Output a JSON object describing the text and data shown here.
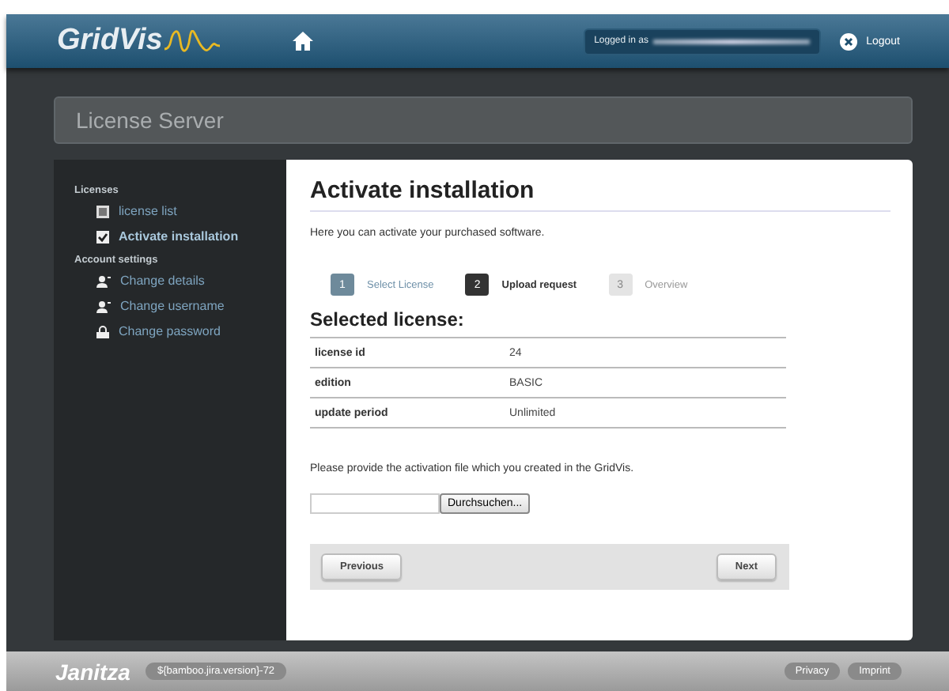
{
  "header": {
    "logo": "GridVis",
    "user_label": "Logged in as",
    "logout": "Logout"
  },
  "page_title": "License Server",
  "sidebar": {
    "sections": [
      {
        "title": "Licenses",
        "items": [
          {
            "label": "license list",
            "kind": "list",
            "selected": false
          },
          {
            "label": "Activate installation",
            "kind": "check",
            "selected": true
          }
        ]
      },
      {
        "title": "Account settings",
        "items": [
          {
            "label": "Change details",
            "kind": "user",
            "selected": false
          },
          {
            "label": "Change username",
            "kind": "user",
            "selected": false
          },
          {
            "label": "Change password",
            "kind": "lock",
            "selected": false
          }
        ]
      }
    ]
  },
  "content": {
    "title": "Activate installation",
    "intro": "Here you can activate your purchased software.",
    "steps": [
      {
        "number": "1",
        "label": "Select License",
        "completed": true,
        "selected": false
      },
      {
        "number": "2",
        "label": "Upload request",
        "completed": false,
        "selected": true
      },
      {
        "number": "3",
        "label": "Overview",
        "completed": false,
        "selected": false
      }
    ],
    "license_heading": "Selected license:",
    "license_rows": [
      {
        "label": "license id",
        "value": "24"
      },
      {
        "label": "edition",
        "value": "BASIC"
      },
      {
        "label": "update period",
        "value": "Unlimited"
      }
    ],
    "file_prompt": "Please provide the activation file which you created in the GridVis.",
    "browse_button": "Durchsuchen...",
    "previous_button": "Previous",
    "next_button": "Next"
  },
  "footer": {
    "logo": "Janitza",
    "version": "${bamboo.jira.version}-72",
    "links": [
      "Privacy",
      "Imprint"
    ]
  }
}
